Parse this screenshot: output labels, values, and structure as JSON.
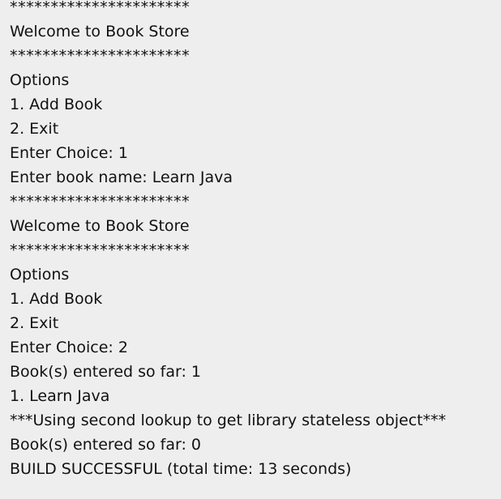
{
  "console": {
    "lines": [
      "**********************",
      "Welcome to Book Store",
      "**********************",
      "Options",
      "1. Add Book",
      "2. Exit",
      "Enter Choice: 1",
      "Enter book name: Learn Java",
      "**********************",
      "Welcome to Book Store",
      "**********************",
      "Options",
      "1. Add Book",
      "2. Exit",
      "Enter Choice: 2",
      "Book(s) entered so far: 1",
      "1. Learn Java",
      "***Using second lookup to get library stateless object***",
      "Book(s) entered so far: 0",
      "BUILD SUCCESSFUL (total time: 13 seconds)"
    ]
  }
}
